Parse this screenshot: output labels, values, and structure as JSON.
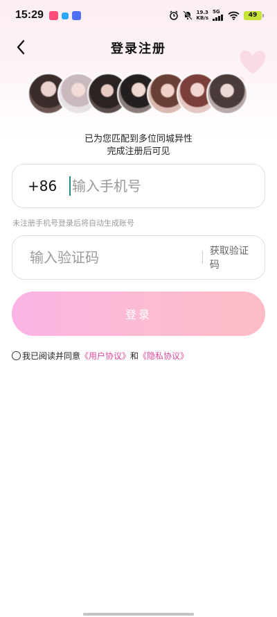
{
  "status_bar": {
    "time": "15:29",
    "net_speed_value": "19.3",
    "net_speed_unit": "KB/s",
    "net_type": "5G",
    "battery": "49",
    "app_icon_colors": [
      "#ff4d7a",
      "#2aa7ff",
      "#4f6ff5"
    ]
  },
  "header": {
    "title": "登录注册",
    "back_icon": "chevron-left-icon"
  },
  "avatars": {
    "count": 7
  },
  "match_text": {
    "line1": "已为您匹配到多位同城异性",
    "line2": "完成注册后可见"
  },
  "phone": {
    "country_code": "+86",
    "placeholder": "输入手机号",
    "value": ""
  },
  "hint": "未注册手机号登录后将自动生成账号",
  "code": {
    "placeholder": "输入验证码",
    "value": "",
    "get_code_label": "获取验证码"
  },
  "login_button": "登录",
  "agreement": {
    "prefix": "我已阅读并同意",
    "user_agreement": "《用户协议》",
    "conjunction": "和",
    "privacy_policy": "《隐私协议》",
    "checked": false
  },
  "colors": {
    "accent": "#e2489b",
    "button_gradient_start": "#fbb4e4",
    "button_gradient_end": "#fcbcc6",
    "cursor": "#1c8b86"
  }
}
